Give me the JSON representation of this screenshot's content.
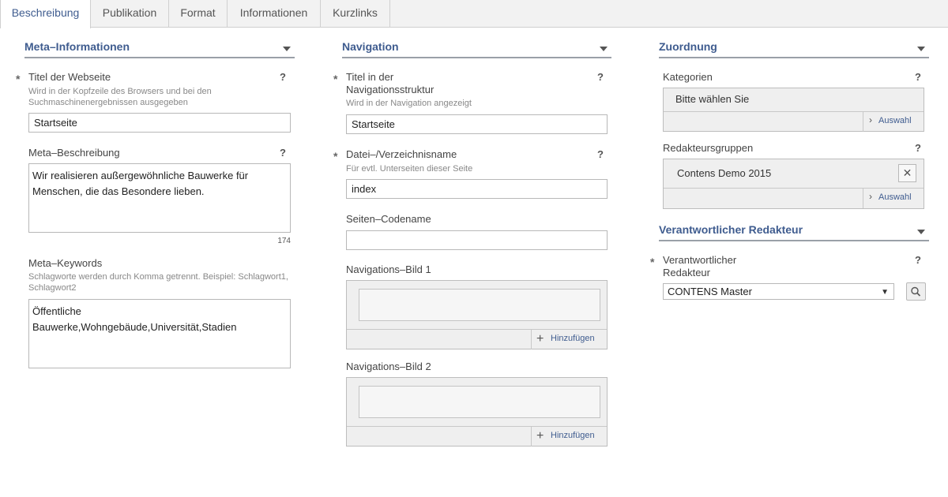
{
  "tabs": [
    "Beschreibung",
    "Publikation",
    "Format",
    "Informationen",
    "Kurzlinks"
  ],
  "active_tab": "Beschreibung",
  "meta": {
    "title": "Meta–Informationen",
    "webpage_title": {
      "label": "Titel der Webseite",
      "hint": "Wird in der Kopfzeile des Browsers und bei den Suchmaschinenergebnissen ausgegeben",
      "value": "Startseite",
      "help": "?",
      "required": "*"
    },
    "description": {
      "label": "Meta–Beschreibung",
      "value": "Wir realisieren außergewöhnliche Bauwerke für Menschen, die das Besondere lieben.",
      "counter": "174",
      "help": "?"
    },
    "keywords": {
      "label": "Meta–Keywords",
      "hint": "Schlagworte werden durch Komma getrennt. Beispiel: Schlagwort1, Schlagwort2",
      "value": "Öffentliche Bauwerke,Wohngebäude,Universität,Stadien"
    }
  },
  "navigation": {
    "title": "Navigation",
    "nav_title": {
      "label": "Titel in der Navigationsstruktur",
      "hint": "Wird in der Navigation angezeigt",
      "value": "Startseite",
      "help": "?",
      "required": "*"
    },
    "filename": {
      "label": "Datei–/Verzeichnisname",
      "hint": "Für evtl. Unterseiten dieser Seite",
      "value": "index",
      "help": "?",
      "required": "*"
    },
    "codename": {
      "label": "Seiten–Codename",
      "value": ""
    },
    "image1": {
      "label": "Navigations–Bild 1",
      "add_label": "Hinzufügen"
    },
    "image2": {
      "label": "Navigations–Bild 2",
      "add_label": "Hinzufügen"
    }
  },
  "assignment": {
    "title": "Zuordnung",
    "categories": {
      "label": "Kategorien",
      "placeholder": "Bitte wählen Sie",
      "select_label": "Auswahl",
      "help": "?"
    },
    "editor_groups": {
      "label": "Redakteursgruppen",
      "item": "Contens Demo 2015",
      "select_label": "Auswahl",
      "help": "?"
    }
  },
  "responsible": {
    "title": "Verantwortlicher Redakteur",
    "field": {
      "label": "Verantwortlicher Redakteur",
      "value": "CONTENS Master",
      "help": "?",
      "required": "*"
    }
  },
  "icons": [
    "chevron-down-icon",
    "help-icon",
    "plus-icon",
    "chevron-right-icon",
    "close-icon",
    "search-icon",
    "caret-down-icon"
  ],
  "colors": {
    "accent": "#3f5c8f",
    "tabbar": "#f2f2f2"
  }
}
